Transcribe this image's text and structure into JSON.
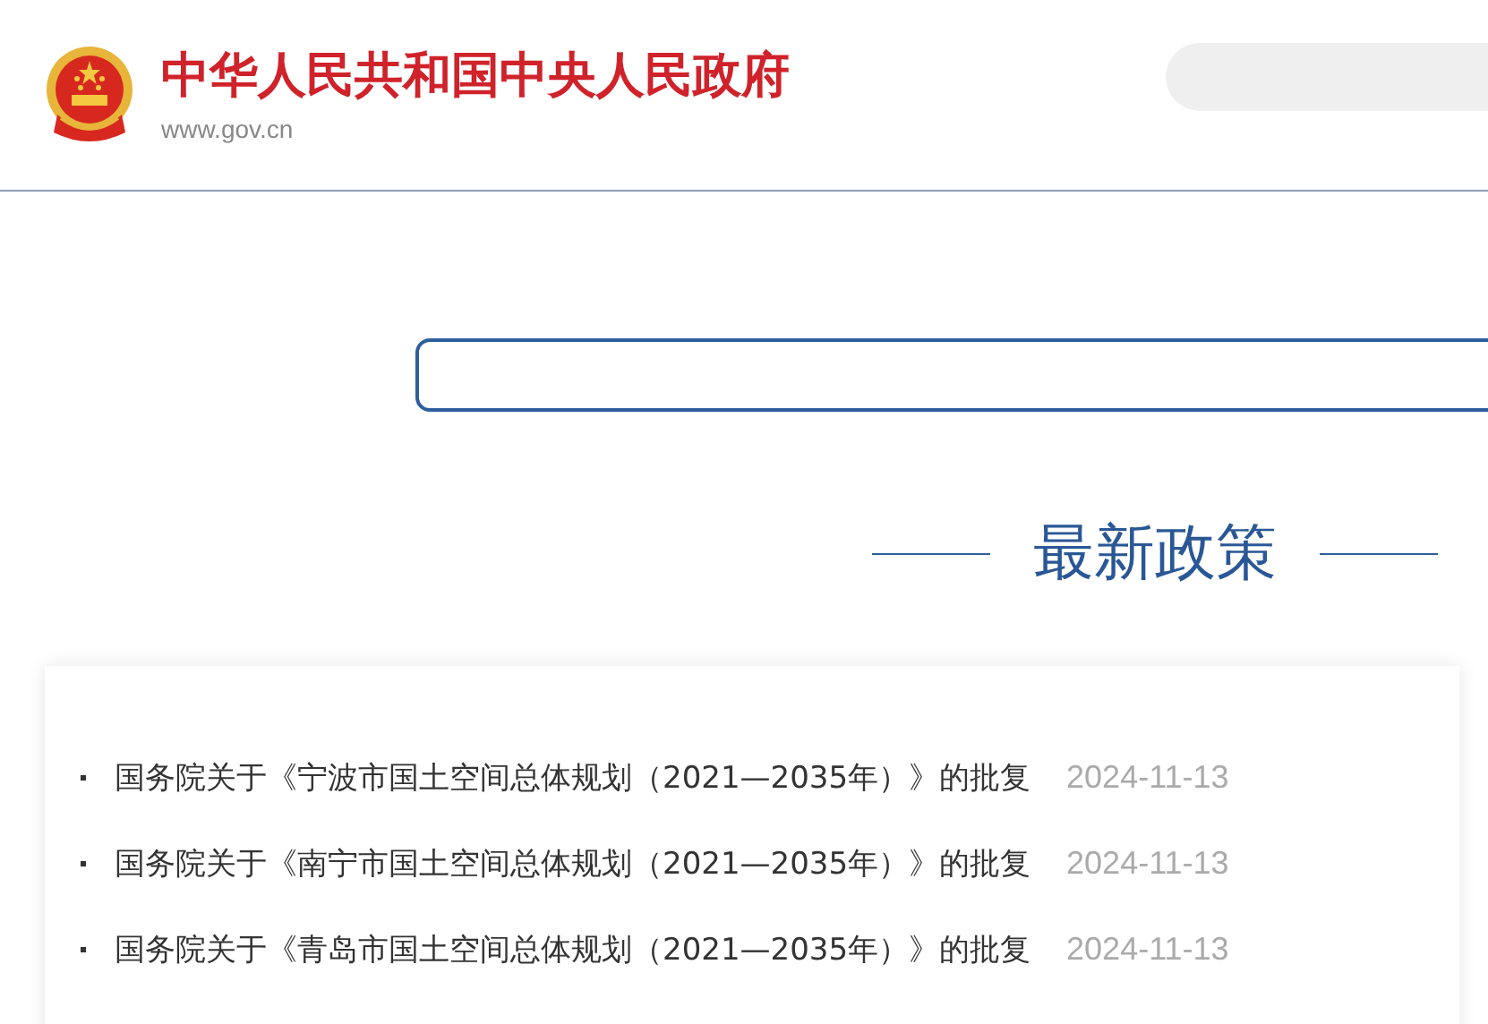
{
  "header": {
    "title": "中华人民共和国中央人民政府",
    "url": "www.gov.cn"
  },
  "section": {
    "title": "最新政策"
  },
  "policies": [
    {
      "title": "国务院关于《宁波市国土空间总体规划（2021—2035年）》的批复",
      "date": "2024-11-13"
    },
    {
      "title": "国务院关于《南宁市国土空间总体规划（2021—2035年）》的批复",
      "date": "2024-11-13"
    },
    {
      "title": "国务院关于《青岛市国土空间总体规划（2021—2035年）》的批复",
      "date": "2024-11-13"
    }
  ]
}
